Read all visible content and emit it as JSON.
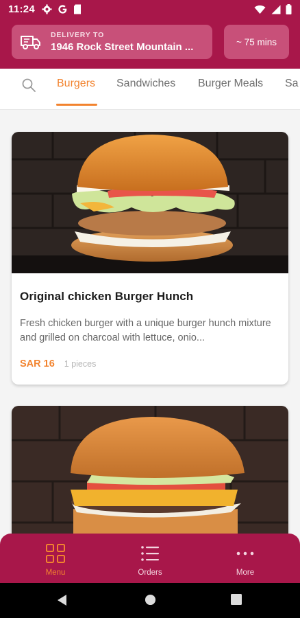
{
  "status_bar": {
    "time": "11:24",
    "left_icons": [
      "gear-icon",
      "google-icon",
      "sim-card-icon"
    ],
    "right_icons": [
      "wifi-icon",
      "signal-icon",
      "battery-icon"
    ]
  },
  "header": {
    "delivery_label": "DELIVERY TO",
    "delivery_address": "1946 Rock Street Mountain ...",
    "eta": "~ 75 mins"
  },
  "tabs": {
    "items": [
      {
        "label": "Burgers",
        "active": true
      },
      {
        "label": "Sandwiches",
        "active": false
      },
      {
        "label": "Burger Meals",
        "active": false
      },
      {
        "label": "Sa",
        "active": false
      }
    ]
  },
  "products": [
    {
      "title": "Original chicken Burger Hunch",
      "description": "Fresh chicken burger with a unique burger hunch mixture and grilled on charcoal with lettuce, onio...",
      "price": "SAR 16",
      "pieces": "1 pieces"
    }
  ],
  "bottom_nav": {
    "items": [
      {
        "label": "Menu",
        "icon": "grid-icon",
        "active": true
      },
      {
        "label": "Orders",
        "icon": "list-icon",
        "active": false
      },
      {
        "label": "More",
        "icon": "more-dots-icon",
        "active": false
      }
    ]
  },
  "colors": {
    "brand": "#a8174a",
    "brand_light": "#c85079",
    "accent": "#f2832e"
  }
}
